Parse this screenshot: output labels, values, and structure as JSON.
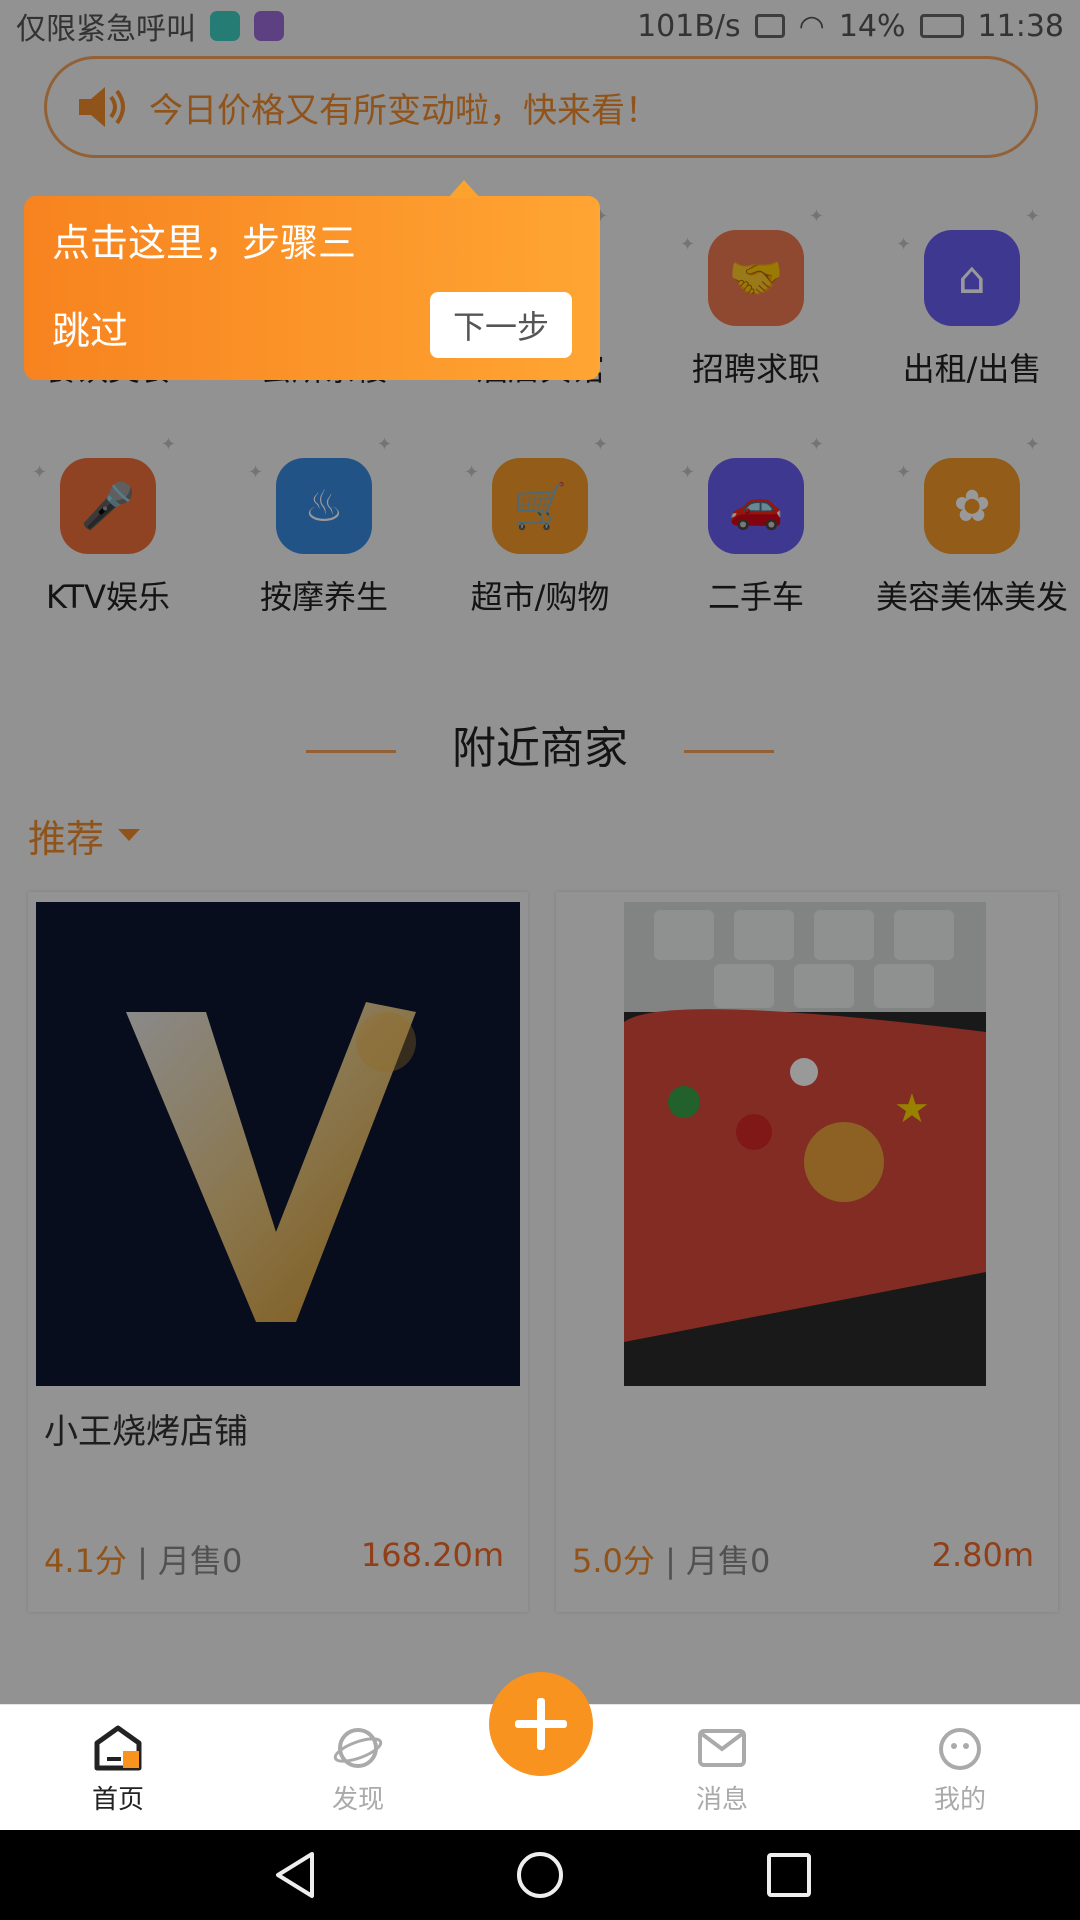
{
  "status_bar": {
    "left_text": "仅限紧急呼叫",
    "net_speed": "101B/s",
    "battery": "14%",
    "time": "11:38"
  },
  "notice": {
    "text": "今日价格又有所变动啦，快来看！",
    "icon": "speaker-icon"
  },
  "categories": [
    {
      "label": "餐饮美食",
      "icon": "food-icon",
      "color": "#f0703a"
    },
    {
      "label": "会所茶楼",
      "icon": "tea-icon",
      "color": "#3a8be0"
    },
    {
      "label": "酒店宾馆",
      "icon": "hotel-icon",
      "color": "#3a8be0"
    },
    {
      "label": "招聘求职",
      "icon": "handshake-icon",
      "color": "#f07a52"
    },
    {
      "label": "出租/出售",
      "icon": "house-icon",
      "color": "#6a5ef0"
    },
    {
      "label": "KTV娱乐",
      "icon": "microphone-icon",
      "color": "#f0703a"
    },
    {
      "label": "按摩养生",
      "icon": "massage-icon",
      "color": "#3a8be0"
    },
    {
      "label": "超市/购物",
      "icon": "cart-icon",
      "color": "#f59a2a"
    },
    {
      "label": "二手车",
      "icon": "car-icon",
      "color": "#6a5ef0"
    },
    {
      "label": "美容美体美发",
      "icon": "beauty-icon",
      "color": "#f59a2a"
    }
  ],
  "section": {
    "title": "附近商家"
  },
  "sort": {
    "label": "推荐"
  },
  "shops": [
    {
      "name": "小王烧烤店铺",
      "rating": "4.1分",
      "sales": "月售0",
      "distance": "168.20m"
    },
    {
      "name": "",
      "rating": "5.0分",
      "sales": "月售0",
      "distance": "2.80m"
    }
  ],
  "guide": {
    "step_text": "点击这里，步骤三",
    "skip_label": "跳过",
    "next_label": "下一步"
  },
  "bottom_nav": [
    {
      "label": "首页",
      "icon": "home-icon",
      "active": true
    },
    {
      "label": "发现",
      "icon": "planet-icon",
      "active": false
    },
    {
      "label": "消息",
      "icon": "mail-icon",
      "active": false
    },
    {
      "label": "我的",
      "icon": "profile-icon",
      "active": false
    }
  ],
  "colors": {
    "accent": "#f7931e",
    "overlay": "rgba(0,0,0,0.40)"
  }
}
